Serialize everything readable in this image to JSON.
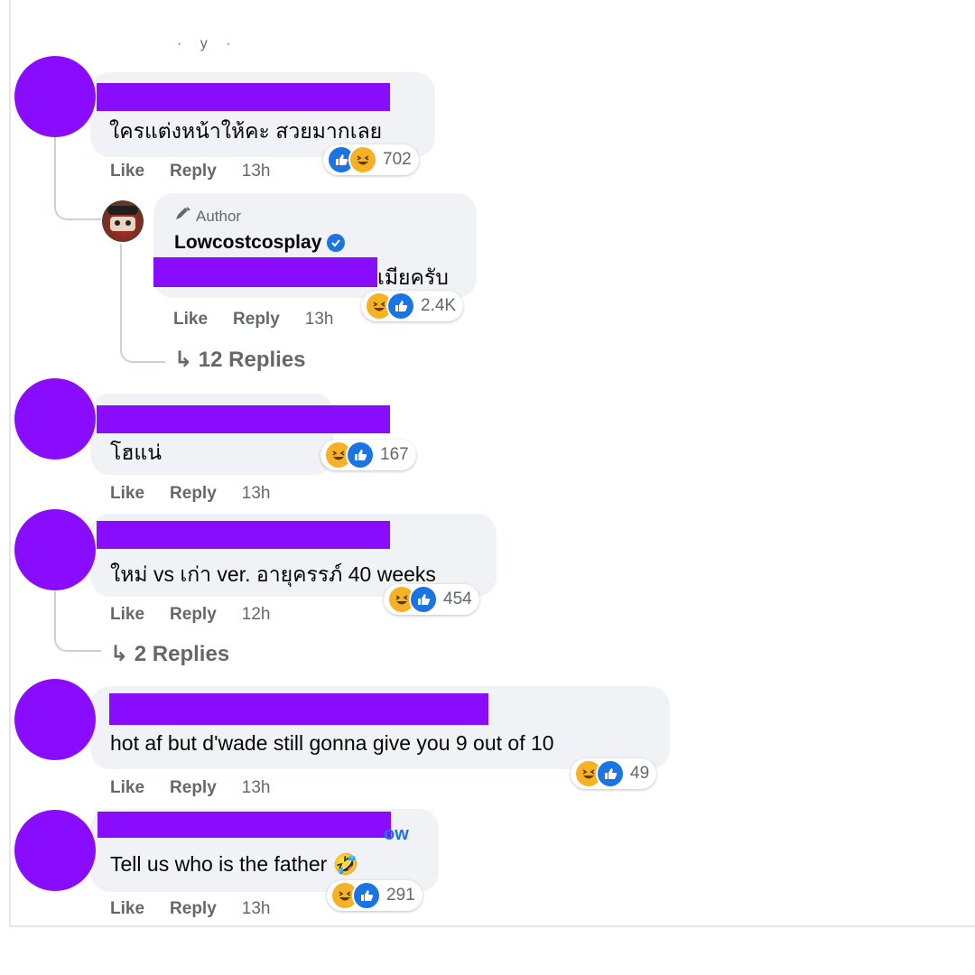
{
  "top_stub": "· y ·",
  "actions": {
    "like": "Like",
    "reply": "Reply"
  },
  "comments": [
    {
      "text": "ใครแต่งหน้าให้คะ สวยมากเลย",
      "time": "13h",
      "reaction_count": "702"
    },
    {
      "badge": "Author",
      "name": "Lowcostcosplay",
      "text": "เมียครับ",
      "time": "13h",
      "reaction_count": "2.4K",
      "replies": "↳ 12 Replies"
    },
    {
      "text": "โฮแน่",
      "time": "13h",
      "reaction_count": "167"
    },
    {
      "text": "ใหม่ vs เก่า ver. อายุครรภ์ 40 weeks",
      "time": "12h",
      "reaction_count": "454",
      "replies": "↳ 2 Replies"
    },
    {
      "text": "hot af but d'wade still gonna give you 9 out of 10",
      "time": "13h",
      "reaction_count": "49"
    },
    {
      "text": "Tell us who is the father",
      "emoji": "🤣",
      "follow": "ow",
      "time": "13h",
      "reaction_count": "291"
    }
  ],
  "colors": {
    "redaction": "#8a0cff",
    "bubble": "#f0f2f5",
    "link": "#1b74e4"
  },
  "icons": [
    "like-icon",
    "haha-icon",
    "pencil-icon",
    "verified-icon",
    "reply-arrow-icon"
  ]
}
